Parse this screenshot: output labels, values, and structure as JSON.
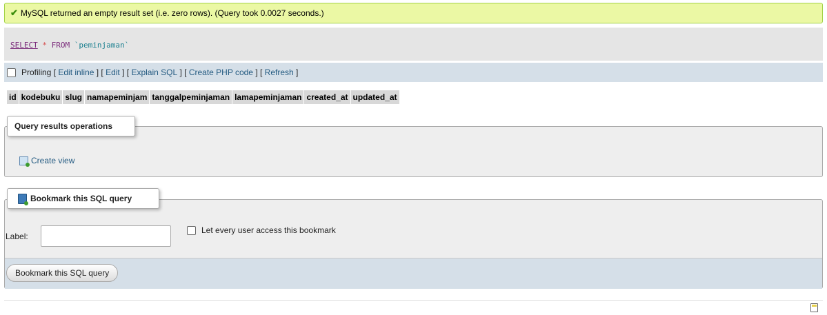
{
  "success_message": {
    "icon": "check-icon",
    "text": "MySQL returned an empty result set (i.e. zero rows). (Query took 0.0027 seconds.)"
  },
  "query": {
    "select": "SELECT",
    "star": "*",
    "from": "FROM",
    "table": "`peminjaman`"
  },
  "tools": {
    "profiling_label": "Profiling",
    "profiling_checked": false,
    "links": [
      "Edit inline",
      "Edit",
      "Explain SQL",
      "Create PHP code",
      "Refresh"
    ]
  },
  "result_columns": [
    "id",
    "kodebuku",
    "slug",
    "namapeminjam",
    "tanggalpeminjaman",
    "lamapeminjaman",
    "created_at",
    "updated_at"
  ],
  "query_results_operations": {
    "legend": "Query results operations",
    "create_view": "Create view"
  },
  "bookmark": {
    "legend": "Bookmark this SQL query",
    "label_text": "Label:",
    "label_value": "",
    "share_label": "Let every user access this bookmark",
    "share_checked": false,
    "submit_label": "Bookmark this SQL query"
  },
  "colors": {
    "success_bg": "#ebf8a4",
    "link": "#235a81",
    "toolbar_bg": "#d5dfe8"
  }
}
